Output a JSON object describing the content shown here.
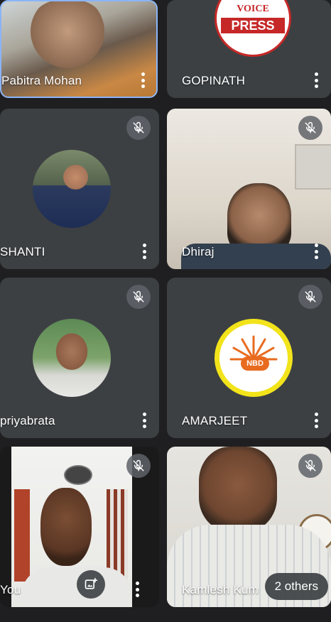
{
  "participants": [
    {
      "name": "Pabitra Mohan"
    },
    {
      "name": "GOPINATH",
      "logo_text": "PRESS",
      "logo_top": "VOICE"
    },
    {
      "name": "SHANTI"
    },
    {
      "name": "Dhiraj"
    },
    {
      "name": "priyabrata"
    },
    {
      "name": "AMARJEET",
      "logo_text": "NBD"
    },
    {
      "name": "You"
    },
    {
      "name": "Kamlesh Kum"
    }
  ],
  "others_badge": "2 others",
  "colors": {
    "tile": "#3c4043",
    "background": "#1f1f21",
    "nbd_ring": "#f2e31b",
    "nbd_accent": "#e86b1f"
  }
}
